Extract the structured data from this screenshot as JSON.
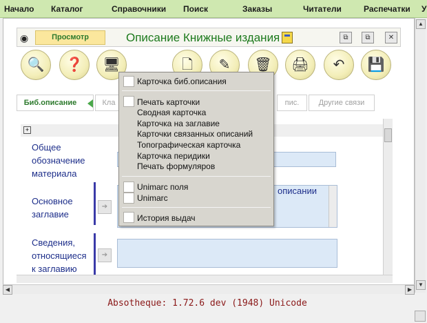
{
  "menu": [
    "Начало",
    "Каталог",
    "Справочники",
    "Поиск",
    "Заказы",
    "Читатели",
    "Распечатки",
    "У"
  ],
  "titlebar": {
    "view_label": "Просмотр",
    "title": "Описание Книжные издания"
  },
  "toolbar_icons": [
    "search-doc-icon",
    "help-book-icon",
    "monitor-icon",
    "new-doc-icon",
    "edit-doc-icon",
    "trash-icon",
    "printer-icon",
    "undo-icon",
    "save-icon"
  ],
  "tabs": [
    {
      "label": "Биб.описание",
      "active": true
    },
    {
      "label": "Кла",
      "active": false
    },
    {
      "label": "пис.",
      "active": false
    },
    {
      "label": "Другие связи",
      "active": false
    }
  ],
  "form": {
    "field1_label_lines": [
      "Общее",
      "обозначение",
      "материала"
    ],
    "field2_label_lines": [
      "Основное",
      "заглавие"
    ],
    "field2_value": "описании",
    "field3_label_lines": [
      "Сведения,",
      "относящиеся",
      "к заглавию"
    ]
  },
  "popup": {
    "items": [
      {
        "label": "Карточка биб.описания",
        "check": true
      },
      {
        "label": "Печать карточки",
        "check": true
      },
      {
        "label": "Сводная карточка",
        "check": false
      },
      {
        "label": "Карточка на заглавие",
        "check": false
      },
      {
        "label": "Карточки связанных описаний",
        "check": false
      },
      {
        "label": "Топографическая карточка",
        "check": false
      },
      {
        "label": "Карточка перидики",
        "check": false
      },
      {
        "label": "Печать формуляров",
        "check": false
      },
      {
        "label": "Unimarc поля",
        "check": true
      },
      {
        "label": "Unimarc",
        "check": true
      },
      {
        "label": "История выдач",
        "check": true
      }
    ]
  },
  "status": "Absotheque: 1.72.6 dev (1948) Unicode"
}
